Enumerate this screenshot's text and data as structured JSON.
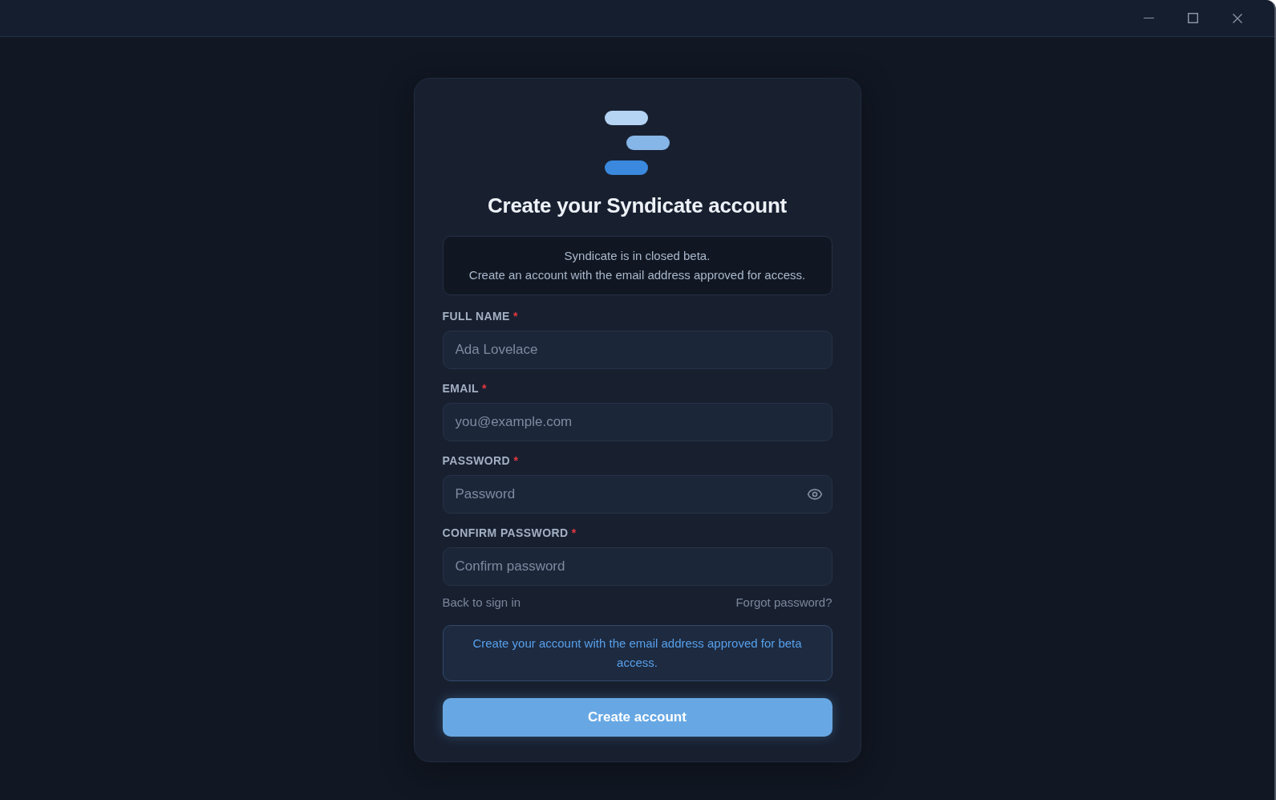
{
  "title": "Create your Syndicate account",
  "notice": {
    "lines": [
      "Syndicate is in closed beta.",
      "Create an account with the email address approved for access."
    ]
  },
  "fields": [
    {
      "label": "FULL NAME",
      "required_mark": "*",
      "placeholder": "Ada Lovelace",
      "show_toggle": false
    },
    {
      "label": "EMAIL",
      "required_mark": "*",
      "placeholder": "you@example.com",
      "show_toggle": false
    },
    {
      "label": "PASSWORD",
      "required_mark": "*",
      "placeholder": "Password",
      "show_toggle": true
    },
    {
      "label": "CONFIRM PASSWORD",
      "required_mark": "*",
      "placeholder": "Confirm password",
      "show_toggle": false
    }
  ],
  "links": [
    {
      "label": "Back to sign in"
    },
    {
      "label": "Forgot password?"
    }
  ],
  "hint": "Create your account with the email address approved for beta access.",
  "submit": {
    "label": "Create account"
  }
}
